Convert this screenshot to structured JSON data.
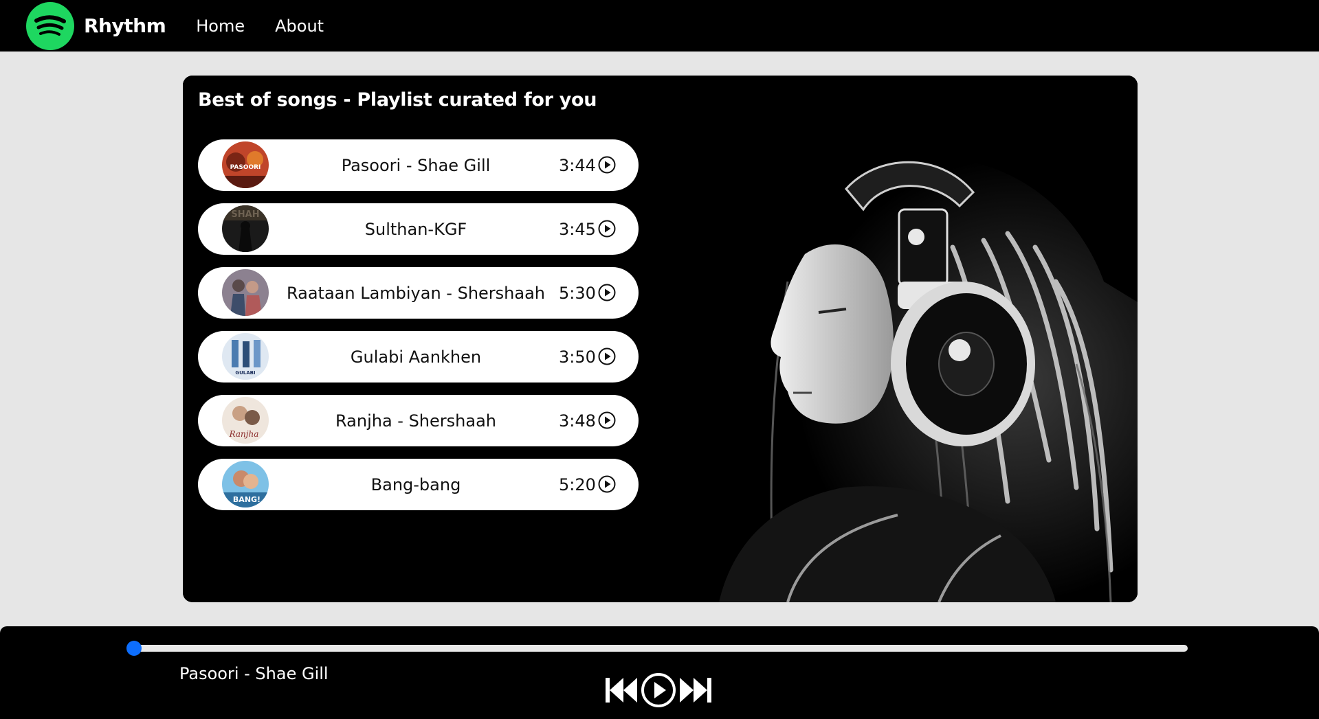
{
  "nav": {
    "brand": "Rhythm",
    "links": [
      "Home",
      "About"
    ]
  },
  "playlist": {
    "title": "Best of songs - Playlist curated for you",
    "songs": [
      {
        "name": "Pasoori - Shae Gill",
        "duration": "3:44",
        "cover_text": "PASOORI",
        "cover_color": "#c0452a"
      },
      {
        "name": "Sulthan-KGF",
        "duration": "3:45",
        "cover_text": "SHAH",
        "cover_color": "#2a2a2a"
      },
      {
        "name": "Raataan Lambiyan - Shershaah",
        "duration": "5:30",
        "cover_text": "",
        "cover_color": "#7a6a78"
      },
      {
        "name": "Gulabi Aankhen",
        "duration": "3:50",
        "cover_text": "GULABI AANKHEN",
        "cover_color": "#4a7bb0"
      },
      {
        "name": "Ranjha - Shershaah",
        "duration": "3:48",
        "cover_text": "Ranjha",
        "cover_color": "#d9b8a0"
      },
      {
        "name": "Bang-bang",
        "duration": "5:20",
        "cover_text": "BANG!",
        "cover_color": "#3f8fc4"
      }
    ]
  },
  "player": {
    "now_playing": "Pasoori - Shae Gill",
    "progress_fraction": 0.0
  },
  "colors": {
    "brand_green": "#1ed760",
    "accent_blue": "#0d6efd",
    "background": "#e6e6e6"
  }
}
